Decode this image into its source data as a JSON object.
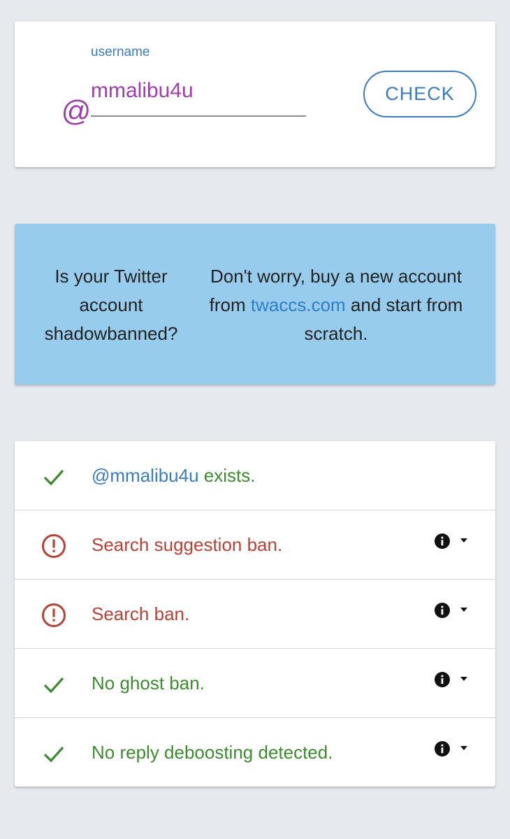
{
  "search": {
    "at_symbol": "@",
    "field_label": "username",
    "username_value": "mmalibu4u",
    "check_label": "CHECK"
  },
  "ad": {
    "left_text": "Is your Twitter account shadowbanned?",
    "right_before": "Don't worry, buy a new account from ",
    "right_link": "twaccs.com",
    "right_after": " and start from scratch."
  },
  "results": [
    {
      "status": "ok",
      "icon": "check-icon",
      "user_mention": "@mmalibu4u",
      "label": " exists.",
      "has_info": false
    },
    {
      "status": "ban",
      "icon": "exclamation-circle-icon",
      "label": "Search suggestion ban.",
      "has_info": true
    },
    {
      "status": "ban",
      "icon": "exclamation-circle-icon",
      "label": "Search ban.",
      "has_info": true
    },
    {
      "status": "ok",
      "icon": "check-icon",
      "label": "No ghost ban.",
      "has_info": true
    },
    {
      "status": "ok",
      "icon": "check-icon",
      "label": "No reply deboosting detected.",
      "has_info": true
    }
  ],
  "colors": {
    "background": "#e6e9ee",
    "accent_blue": "#3a7cbf",
    "purple": "#9c3fa8",
    "ad_background": "#97ccec",
    "ok_green": "#3d8b2f",
    "ban_red": "#b84236"
  }
}
